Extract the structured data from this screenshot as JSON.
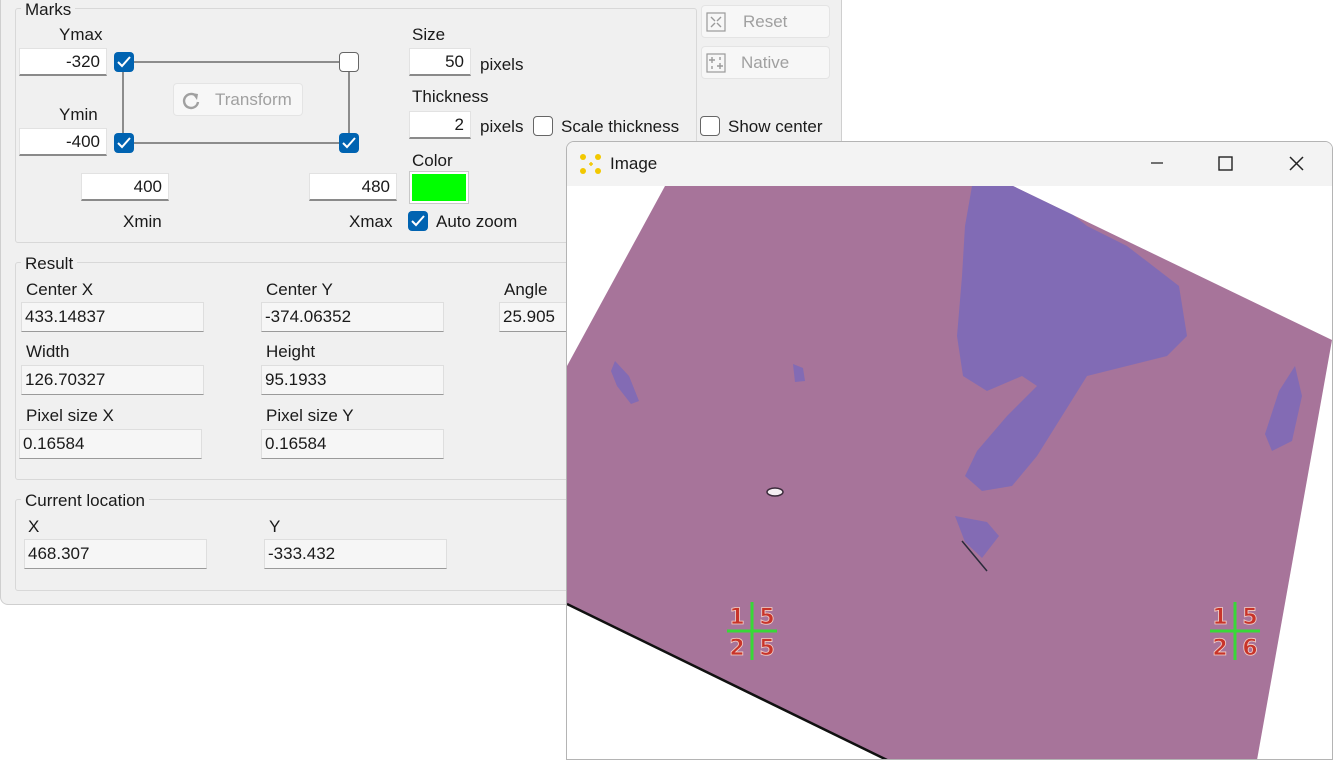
{
  "marks": {
    "title": "Marks",
    "ymax_label": "Ymax",
    "ymax_value": "-320",
    "ymin_label": "Ymin",
    "ymin_value": "-400",
    "xmin_label": "Xmin",
    "xmin_value": "400",
    "xmax_label": "Xmax",
    "xmax_value": "480",
    "transform_label": "Transform",
    "size_label": "Size",
    "size_value": "50",
    "size_unit": "pixels",
    "thickness_label": "Thickness",
    "thickness_value": "2",
    "thickness_unit": "pixels",
    "scale_thickness_label": "Scale thickness",
    "scale_thickness_checked": false,
    "color_label": "Color",
    "color_value": "#00ff00",
    "auto_zoom_label": "Auto zoom",
    "auto_zoom_checked": true,
    "corner_top_left_checked": true,
    "corner_top_right_checked": false,
    "corner_bottom_left_checked": true,
    "corner_bottom_right_checked": true
  },
  "buttons": {
    "reset_label": "Reset",
    "native_label": "Native",
    "show_center_label": "Show center",
    "show_center_checked": false
  },
  "result": {
    "title": "Result",
    "center_x_label": "Center X",
    "center_x_value": "433.14837",
    "center_y_label": "Center Y",
    "center_y_value": "-374.06352",
    "angle_label": "Angle",
    "angle_value": "25.905",
    "width_label": "Width",
    "width_value": "126.70327",
    "height_label": "Height",
    "height_value": "95.1933",
    "pixel_size_x_label": "Pixel size X",
    "pixel_size_x_value": "0.16584",
    "pixel_size_y_label": "Pixel size Y",
    "pixel_size_y_value": "0.16584"
  },
  "location": {
    "title": "Current location",
    "x_label": "X",
    "x_value": "468.307",
    "y_label": "Y",
    "y_value": "-333.432"
  },
  "image_window": {
    "title": "Image",
    "marker_left_digits": [
      "1",
      "5",
      "2",
      "5"
    ],
    "marker_right_digits": [
      "1",
      "5",
      "2",
      "6"
    ],
    "colors": {
      "substrate": "#a7749a",
      "flake": "#7d6ab8",
      "marker_cross": "#38d838",
      "marker_digit": "#c8342a"
    }
  }
}
